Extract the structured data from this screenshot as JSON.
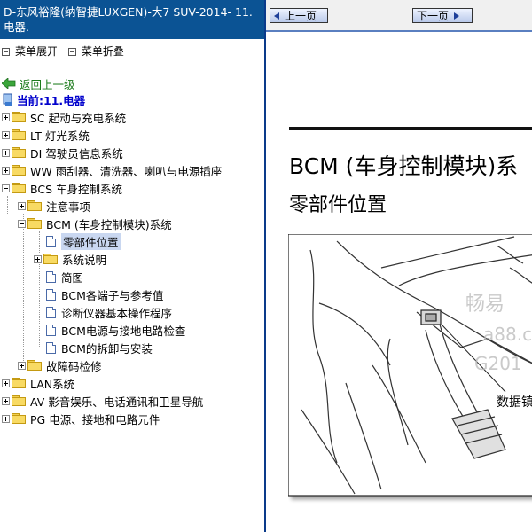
{
  "window_title": "D-东风裕隆(纳智捷LUXGEN)-大7 SUV-2014- 11.电器.",
  "menu": {
    "expand": "菜单展开",
    "collapse": "菜单折叠"
  },
  "back_link": "返回上一级",
  "current": "当前:11.电器",
  "tree": [
    {
      "label": "SC 起动与充电系统"
    },
    {
      "label": "LT 灯光系统"
    },
    {
      "label": "DI 驾驶员信息系统"
    },
    {
      "label": "WW 雨刮器、清洗器、喇叭与电源插座"
    },
    {
      "label": "BCS 车身控制系统"
    },
    {
      "label": "注意事项"
    },
    {
      "label": "BCM (车身控制模块)系统"
    },
    {
      "label": "零部件位置"
    },
    {
      "label": "系统说明"
    },
    {
      "label": "简图"
    },
    {
      "label": "BCM各端子与参考值"
    },
    {
      "label": "诊断仪器基本操作程序"
    },
    {
      "label": "BCM电源与接地电路检查"
    },
    {
      "label": "BCM的拆卸与安装"
    },
    {
      "label": "故障码检修"
    },
    {
      "label": "LAN系统"
    },
    {
      "label": "AV 影音娱乐、电话通讯和卫星导航"
    },
    {
      "label": "PG 电源、接地和电路元件"
    }
  ],
  "nav": {
    "prev": "上一页",
    "next": "下一页"
  },
  "document": {
    "title": "BCM (车身控制模块)系",
    "subtitle": "零部件位置",
    "callout": "数据镇",
    "watermark": [
      "畅易",
      "a88.c",
      "G201"
    ]
  }
}
